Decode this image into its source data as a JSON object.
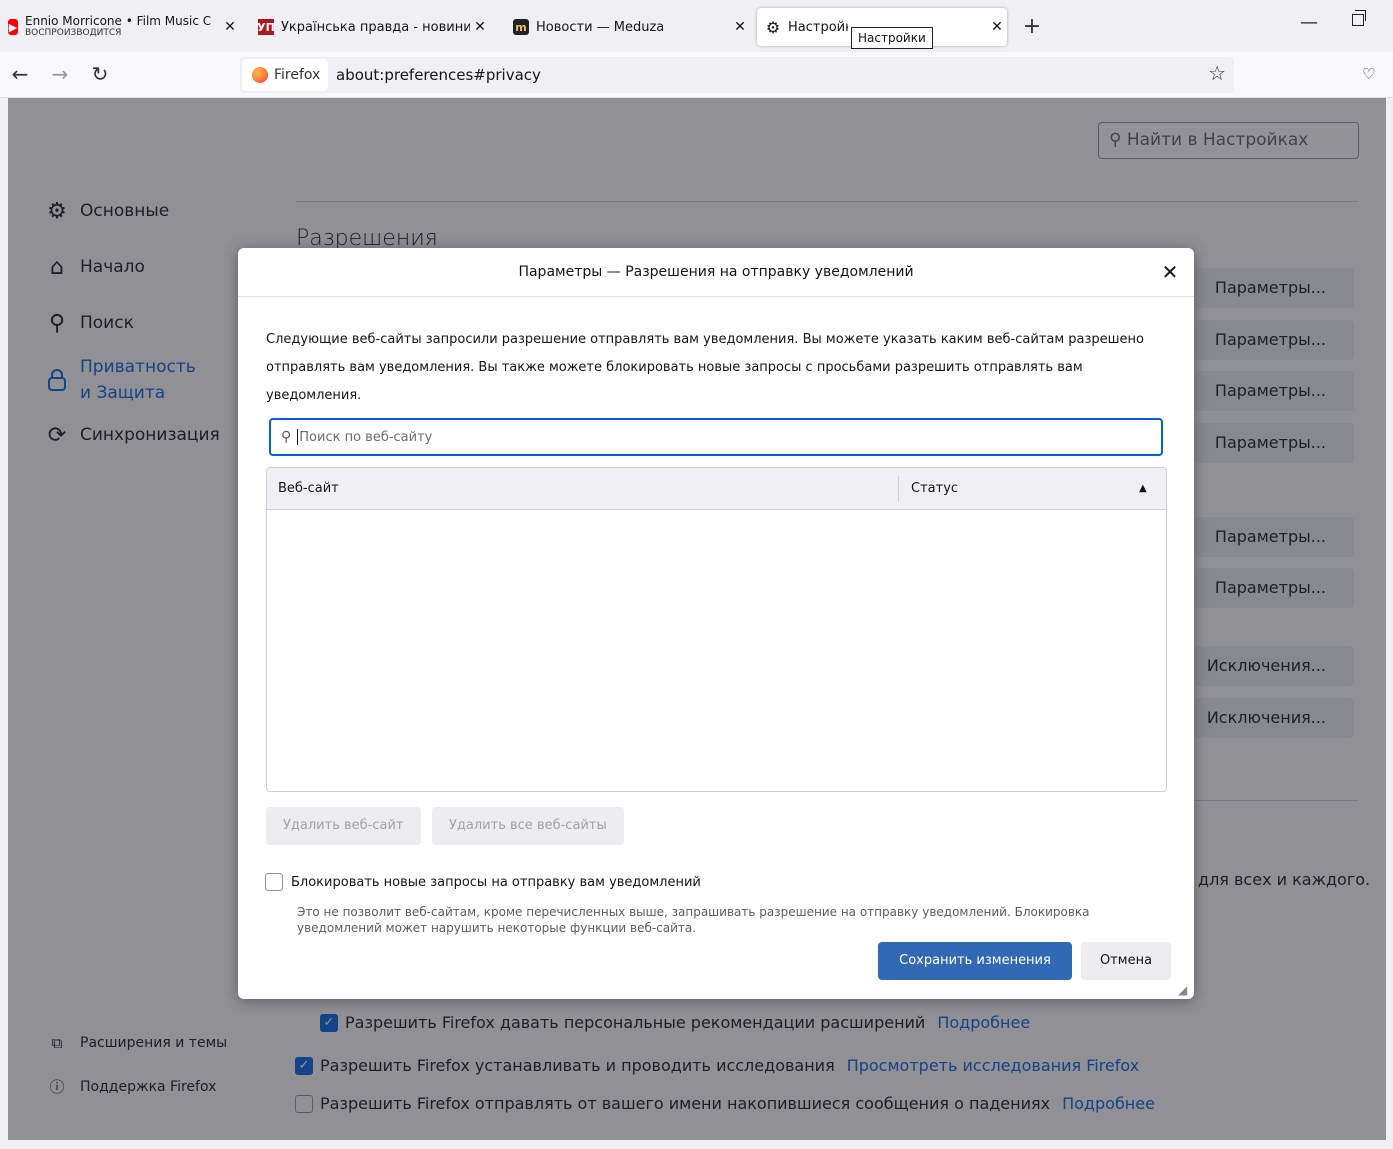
{
  "tabs": [
    {
      "title": "Ennio Morricone • Film Music C",
      "subtitle": "ВОСПРОИЗВОДИТСЯ",
      "icon": "youtube-icon"
    },
    {
      "title": "Українська правда - новини он",
      "icon": "up-logo-icon"
    },
    {
      "title": "Новости — Meduza",
      "icon": "meduza-logo-icon"
    },
    {
      "title": "Настройки",
      "icon": "gear-icon"
    }
  ],
  "tooltip": "Настройки",
  "urlbar": {
    "identity": "Firefox",
    "url": "about:preferences#privacy"
  },
  "prefs": {
    "search_placeholder": "Найти в Настройках",
    "categories": [
      {
        "label": "Основные"
      },
      {
        "label": "Начало"
      },
      {
        "label": "Поиск"
      },
      {
        "label": "Приватность и Защита"
      },
      {
        "label": "Синхронизация"
      }
    ],
    "footer": {
      "extensions": "Расширения и темы",
      "support": "Поддержка Firefox"
    },
    "section_heading": "Разрешения",
    "buttons": [
      "Параметры...",
      "Параметры...",
      "Параметры...",
      "Параметры...",
      "Параметры...",
      "Параметры...",
      "Исключения...",
      "Исключения..."
    ],
    "partial_text": "для всех и каждого.",
    "checkboxes": [
      {
        "label": "Разрешить Firefox давать персональные рекомендации расширений",
        "link": "Подробнее",
        "checked": true
      },
      {
        "label": "Разрешить Firefox устанавливать и проводить исследования",
        "link": "Просмотреть исследования Firefox",
        "checked": true
      },
      {
        "label": "Разрешить Firefox отправлять от вашего имени накопившиеся сообщения о падениях",
        "link": "Подробнее",
        "checked": false
      }
    ]
  },
  "dialog": {
    "title": "Параметры — Разрешения на отправку уведомлений",
    "description": "Следующие веб-сайты запросили разрешение отправлять вам уведомления. Вы можете указать каким веб-сайтам разрешено отправлять вам уведомления. Вы также можете блокировать новые запросы с просьбами разрешить отправлять вам уведомления.",
    "search_placeholder": "Поиск по веб-сайту",
    "columns": [
      "Веб-сайт",
      "Статус"
    ],
    "rows": [],
    "remove_label": "Удалить веб-сайт",
    "remove_all_label": "Удалить все веб-сайты",
    "block_label": "Блокировать новые запросы на отправку вам уведомлений",
    "block_checked": false,
    "block_note": "Это не позволит веб-сайтам, кроме перечисленных выше, запрашивать разрешение на отправку уведомлений. Блокировка уведомлений может нарушить некоторые функции веб-сайта.",
    "save_label": "Сохранить изменения",
    "cancel_label": "Отмена"
  },
  "colors": {
    "accent": "#0061e0",
    "save_button": "#3269b4"
  }
}
